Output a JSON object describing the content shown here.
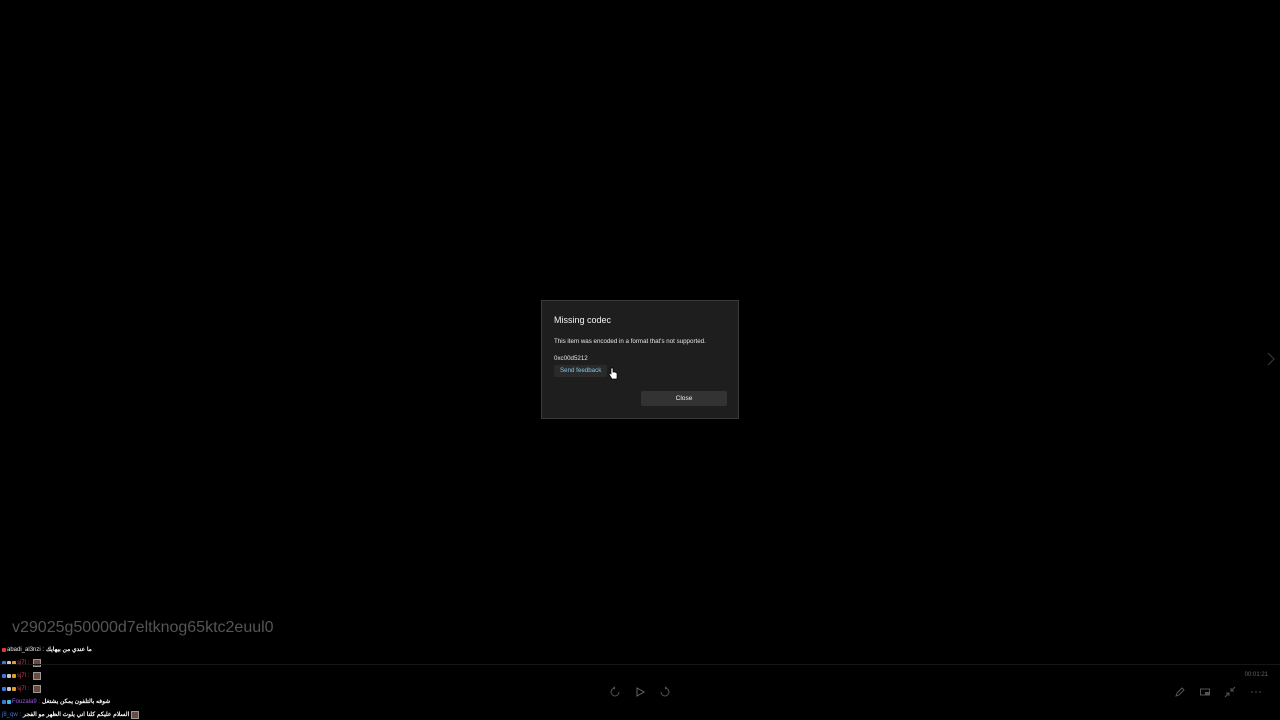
{
  "dialog": {
    "title": "Missing codec",
    "message": "This item was encoded in a format that's not supported.",
    "error_code": "0xc00d5212",
    "feedback_label": "Send feedback",
    "close_label": "Close"
  },
  "overlay": {
    "file_name": "v29025g50000d7eltknog65ktc2euul0"
  },
  "chat": [
    {
      "user": "abadi_al3nzi :",
      "user_color": "#e8e8e8",
      "msg": "ما عندي من بيهايك",
      "badges": [
        "#e03a3a"
      ],
      "emote": false
    },
    {
      "user": "sj7l :",
      "user_color": "#d43b4f",
      "msg": "",
      "badges": [
        "#3a7ae0",
        "#c8c8c8",
        "#e0a030"
      ],
      "emote": true
    },
    {
      "user": "sj7l :",
      "user_color": "#d43b4f",
      "msg": "",
      "badges": [
        "#3a7ae0",
        "#c8c8c8",
        "#e0a030"
      ],
      "emote": true
    },
    {
      "user": "sj7l :",
      "user_color": "#d43b4f",
      "msg": "",
      "badges": [
        "#3a7ae0",
        "#c8c8c8",
        "#e0a030"
      ],
      "emote": true
    },
    {
      "user": "Fouzala9 :",
      "user_color": "#9a5be0",
      "msg": "شوفه بالتلفون يمكن يشتغل",
      "badges": [
        "#3a7ae0",
        "#3ac0e0"
      ],
      "emote": false
    },
    {
      "user": "j8_qw :",
      "user_color": "#3a7ae0",
      "msg": "السلام عليكم كلنا اني يلوث الظهر مو الفجر",
      "badges": [],
      "emote": true
    }
  ],
  "player": {
    "timestamp": "00:01:21"
  },
  "colors": {
    "background": "#000000",
    "dialog_bg": "#1e1e1e",
    "link": "#7fc8e8"
  }
}
